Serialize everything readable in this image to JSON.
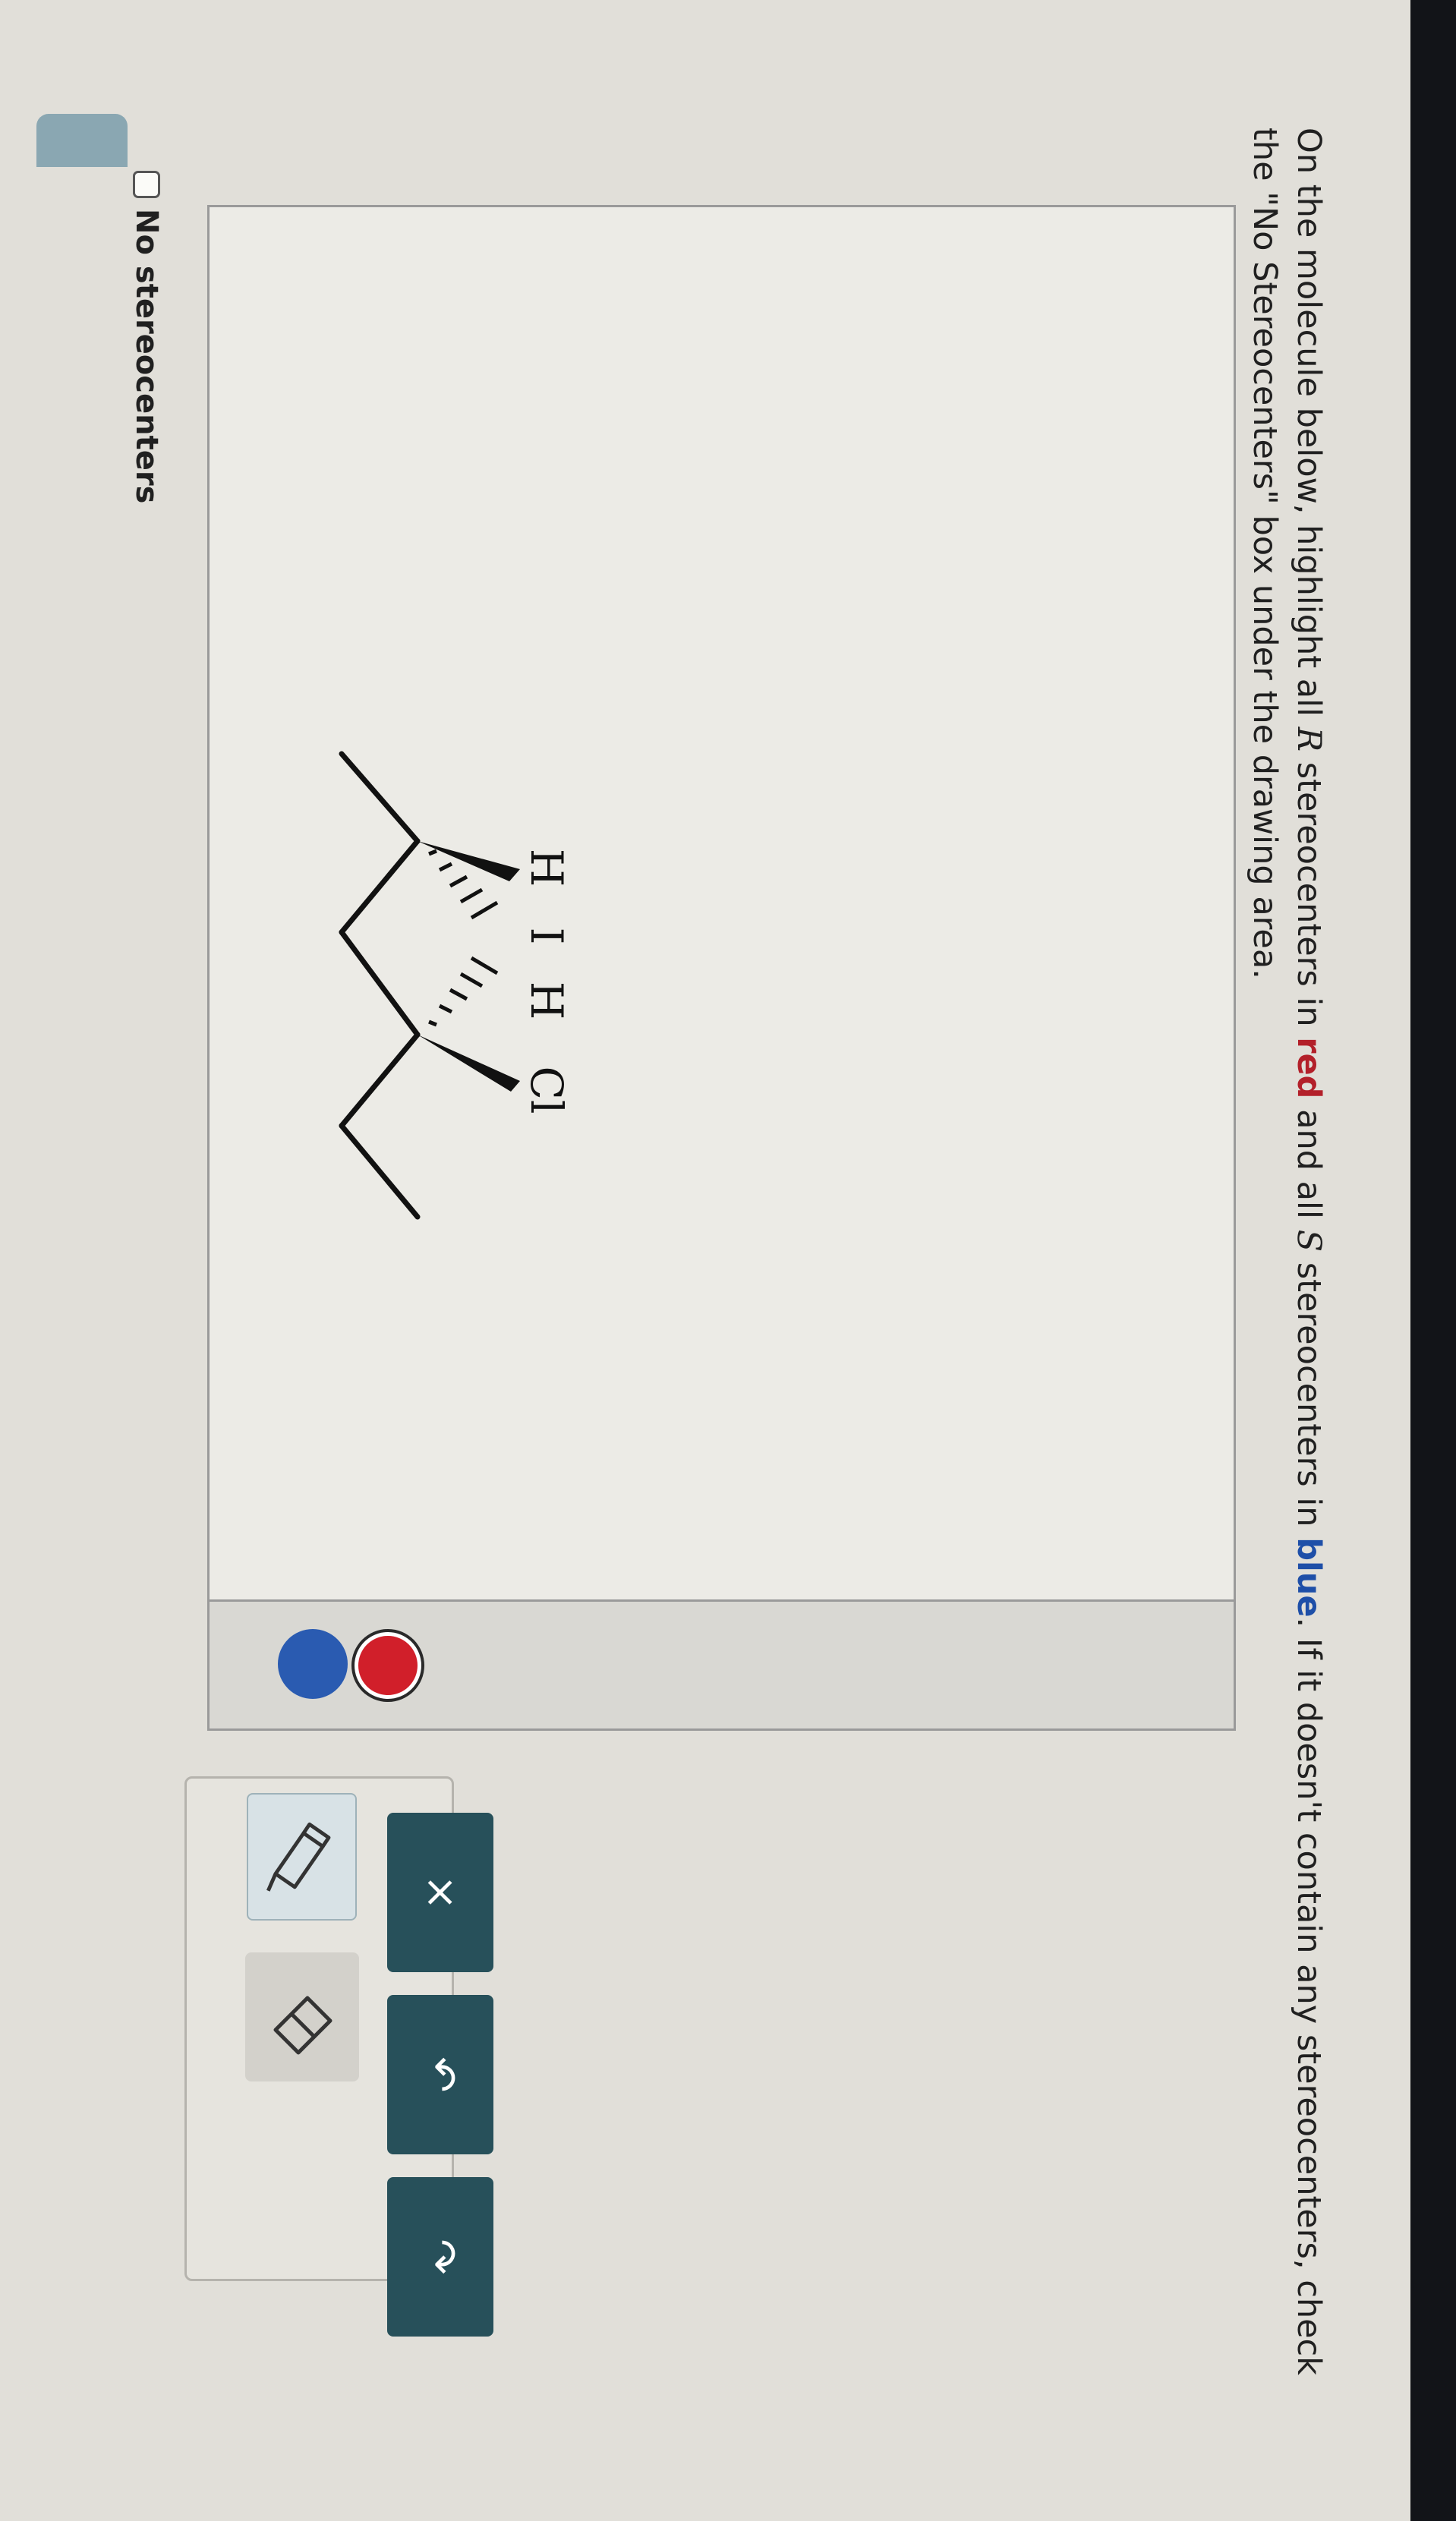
{
  "instructions": {
    "part1": "On the molecule below, highlight all ",
    "r": "R",
    "part2": " stereocenters in ",
    "red_word": "red",
    "part3": " and all ",
    "s": "S",
    "part4": " stereocenters in ",
    "blue_word": "blue",
    "part5": ". If it doesn't contain any stereocenters, check the \"No Stereocenters\" box under the drawing area."
  },
  "molecule": {
    "atom_labels": [
      "H",
      "I",
      "H",
      "Cl"
    ]
  },
  "colors": {
    "red": "#d11f2a",
    "blue": "#2a5bb1",
    "button": "#27505a"
  },
  "tools": {
    "highlight_icon": "highlighter-icon",
    "eraser_icon": "eraser-icon"
  },
  "actions": {
    "clear": "×",
    "undo": "↶",
    "redo": "↷"
  },
  "no_stereocenters": {
    "label": "No stereocenters",
    "checked": false
  }
}
